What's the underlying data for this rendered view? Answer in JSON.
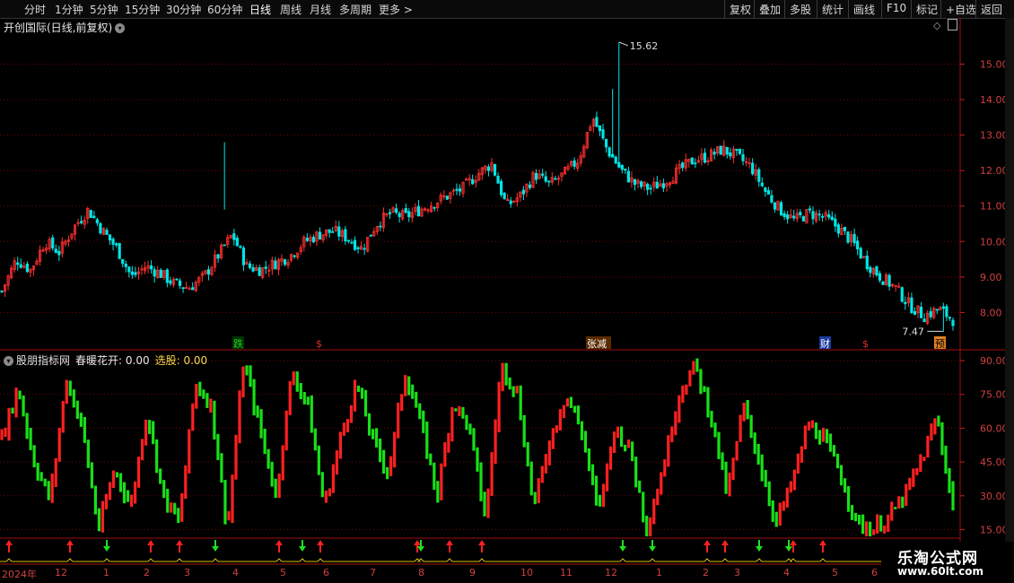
{
  "toolbar": {
    "periods": [
      "分时",
      "1分钟",
      "5分钟",
      "15分钟",
      "30分钟",
      "60分钟",
      "日线",
      "周线",
      "月线",
      "多周期",
      "更多 >"
    ],
    "active": "日线",
    "actions": [
      "复权",
      "叠加",
      "多股",
      "统计",
      "画线",
      "F10",
      "标记",
      "+自选",
      "返回"
    ]
  },
  "main": {
    "title": "开创国际(日线,前复权)",
    "high_label": "15.62",
    "low_label": "7.47",
    "y_ticks": [
      "15.00",
      "14.00",
      "13.00",
      "12.00",
      "11.00",
      "10.00",
      "9.00",
      "8.00"
    ],
    "markers": [
      {
        "text": "跌",
        "color": "#22cc22",
        "bg": "#003300"
      },
      {
        "text": "$",
        "color": "#e03030",
        "bg": ""
      },
      {
        "text": "张减",
        "color": "#ffffff",
        "bg": "#5a2a00"
      },
      {
        "text": "财",
        "color": "#ffffff",
        "bg": "#1a3aa0"
      },
      {
        "text": "$",
        "color": "#e03030",
        "bg": ""
      },
      {
        "text": "预",
        "color": "#000000",
        "bg": "#e08020"
      }
    ]
  },
  "indicator": {
    "name": "股朋指标网",
    "line1": "春暖花开: 0.00",
    "line2": "选股: 0.00",
    "y_ticks": [
      "90.00",
      "75.00",
      "60.00",
      "45.00",
      "30.00",
      "15.00"
    ]
  },
  "date_axis": [
    "2024年",
    "12",
    "1",
    "2",
    "3",
    "4",
    "5",
    "6",
    "7",
    "8",
    "9",
    "10",
    "11",
    "12",
    "1",
    "2",
    "3",
    "4",
    "5",
    "6"
  ],
  "watermark": {
    "line1": "乐淘公式网",
    "line2": "www.60lt.com"
  },
  "colors": {
    "up": "#ff3030",
    "down": "#00e5e5",
    "ind_up": "#ff2020",
    "ind_down": "#18e018",
    "grid": "#7a0000"
  },
  "chart_data": {
    "type": "candlestick",
    "price_path": [
      8.6,
      9.5,
      9.2,
      10.0,
      9.7,
      10.4,
      10.9,
      10.3,
      9.8,
      9.0,
      9.3,
      9.1,
      8.8,
      8.7,
      9.0,
      9.6,
      10.2,
      9.3,
      9.2,
      9.4,
      9.6,
      10.0,
      10.2,
      10.3,
      10.1,
      9.8,
      10.5,
      10.8,
      10.7,
      10.9,
      11.1,
      11.3,
      11.5,
      11.9,
      12.2,
      11.0,
      11.3,
      11.9,
      11.6,
      11.9,
      12.3,
      13.5,
      12.6,
      12.0,
      11.6,
      11.5,
      11.7,
      12.0,
      12.3,
      12.4,
      12.6,
      12.4,
      12.1,
      11.4,
      10.9,
      10.6,
      10.8,
      10.7,
      10.4,
      10.0,
      9.4,
      9.0,
      8.7,
      8.2,
      7.9,
      8.1,
      7.8
    ],
    "ylim": [
      7.0,
      16.2
    ],
    "high": 15.62,
    "low": 7.47,
    "indicator_path": [
      55,
      78,
      45,
      28,
      82,
      60,
      15,
      42,
      25,
      68,
      30,
      18,
      80,
      70,
      15,
      90,
      60,
      30,
      85,
      70,
      25,
      55,
      80,
      55,
      40,
      85,
      62,
      30,
      72,
      60,
      20,
      88,
      75,
      25,
      55,
      75,
      58,
      22,
      60,
      50,
      15,
      42,
      75,
      88,
      65,
      30,
      70,
      45,
      18,
      35,
      62,
      55,
      40,
      18,
      15,
      20,
      30,
      45,
      65,
      25
    ],
    "indicator_ylim": [
      12,
      94
    ],
    "up_arrows_x": [
      10,
      78,
      168,
      200,
      311,
      357,
      465,
      501,
      537,
      788,
      808,
      884,
      917
    ],
    "down_arrows_x": [
      119,
      240,
      337,
      469,
      694,
      727,
      846,
      879
    ]
  }
}
